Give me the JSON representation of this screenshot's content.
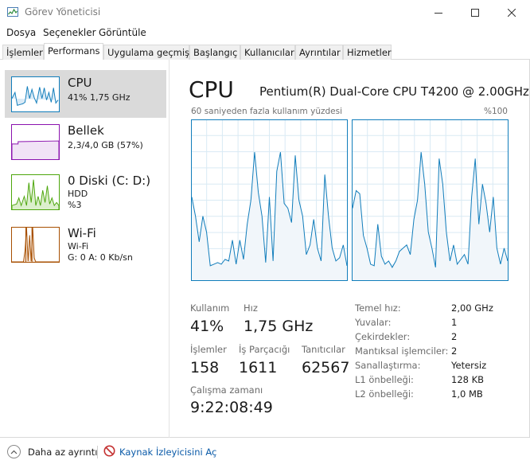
{
  "window": {
    "title": "Görev Yöneticisi"
  },
  "menu": [
    "Dosya",
    "Seçenekler",
    "Görüntüle"
  ],
  "tabs": [
    "İşlemler",
    "Performans",
    "Uygulama geçmişi",
    "Başlangıç",
    "Kullanıcılar",
    "Ayrıntılar",
    "Hizmetler"
  ],
  "sidebar": [
    {
      "title": "CPU",
      "lines": [
        "41% 1,75 GHz"
      ],
      "color": "#117dbb"
    },
    {
      "title": "Bellek",
      "lines": [
        "2,3/4,0 GB (57%)"
      ],
      "color": "#8b12ae"
    },
    {
      "title": "0 Diski (C: D:)",
      "lines": [
        "HDD",
        "%3"
      ],
      "color": "#4da60c"
    },
    {
      "title": "Wi-Fi",
      "lines": [
        "Wi-Fi",
        "G: 0 A: 0 Kb/sn"
      ],
      "color": "#a74f01"
    }
  ],
  "main": {
    "title": "CPU",
    "model": "Pentium(R) Dual-Core CPU T4200 @ 2.00GHz",
    "graph_label": "60 saniyeden fazla kullanım yüzdesi",
    "graph_max": "%100",
    "accent": "#117dbb"
  },
  "chart_data": {
    "type": "area",
    "xlabel": "60 saniyeden fazla kullanım yüzdesi",
    "ylim": [
      0,
      100
    ],
    "series": [
      {
        "values": [
          52,
          40,
          24,
          40,
          30,
          9,
          10,
          11,
          10,
          13,
          12,
          25,
          10,
          25,
          13,
          35,
          50,
          80,
          55,
          40,
          11,
          52,
          12,
          68,
          80,
          48,
          45,
          36,
          78,
          50,
          40,
          16,
          22,
          38,
          20,
          12,
          66,
          40,
          20,
          12,
          14,
          22,
          9
        ]
      },
      {
        "values": [
          45,
          56,
          54,
          28,
          20,
          10,
          9,
          35,
          15,
          10,
          12,
          8,
          12,
          18,
          20,
          22,
          16,
          38,
          50,
          80,
          60,
          30,
          20,
          8,
          76,
          60,
          30,
          12,
          22,
          10,
          13,
          16,
          10,
          52,
          76,
          35,
          60,
          48,
          30,
          52,
          20,
          10,
          20,
          12
        ]
      }
    ]
  },
  "stats": {
    "usage_label": "Kullanım",
    "usage": "41%",
    "speed_label": "Hız",
    "speed": "1,75 GHz",
    "processes_label": "İşlemler",
    "processes": "158",
    "threads_label": "İş Parçacığı",
    "threads": "1611",
    "handles_label": "Tanıtıcılar",
    "handles": "62567",
    "uptime_label": "Çalışma zamanı",
    "uptime": "9:22:08:49"
  },
  "specs": [
    {
      "label": "Temel hız:",
      "value": "2,00 GHz"
    },
    {
      "label": "Yuvalar:",
      "value": "1"
    },
    {
      "label": "Çekirdekler:",
      "value": "2"
    },
    {
      "label": "Mantıksal işlemciler:",
      "value": "2"
    },
    {
      "label": "Sanallaştırma:",
      "value": "Yetersiz"
    },
    {
      "label": "L1 önbelleği:",
      "value": "128 KB"
    },
    {
      "label": "L2 önbelleği:",
      "value": "1,0 MB"
    }
  ],
  "footer": {
    "less_details": "Daha az ayrıntı",
    "open_monitor": "Kaynak İzleyicisini Aç"
  }
}
